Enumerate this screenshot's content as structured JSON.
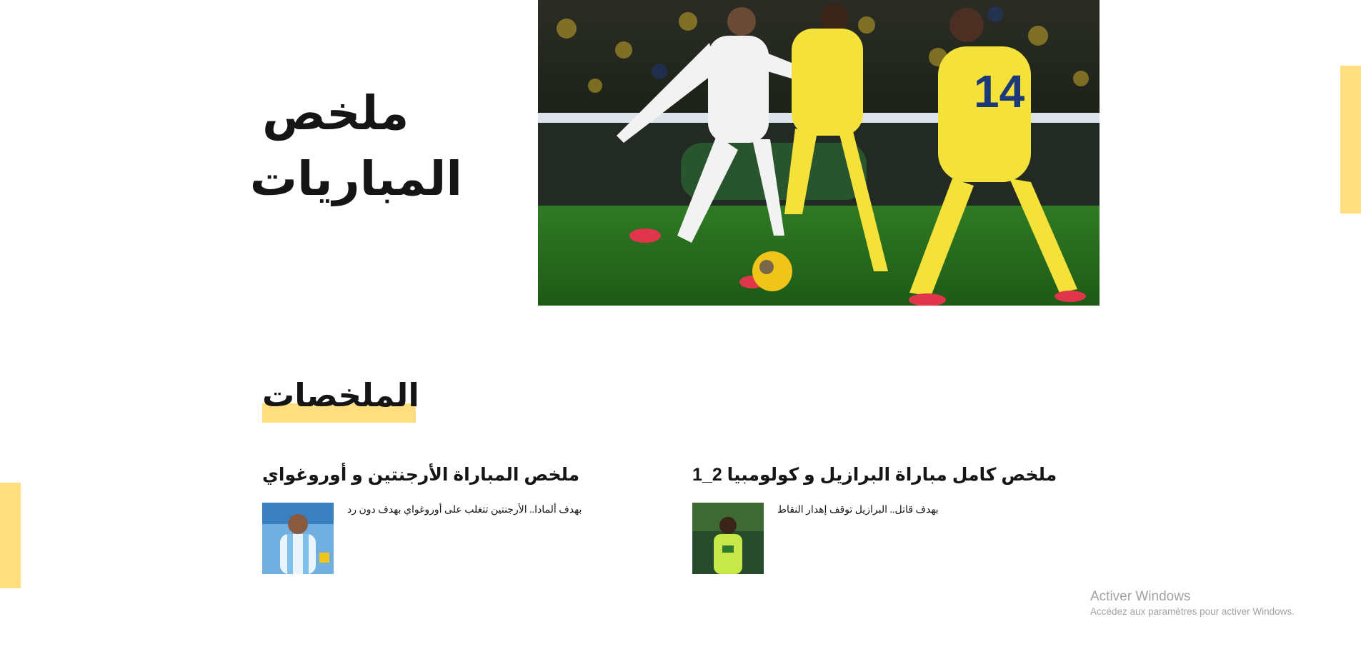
{
  "hero": {
    "title_line1": "ملخص",
    "title_line2": "المباريات",
    "photo": "football-match-photo"
  },
  "section": {
    "title": "الملخصات"
  },
  "cards": [
    {
      "title": "ملخص المباراة الأرجنتين و أوروغواي",
      "description": "بهدف ألمادا.. الأرجنتين تتغلب على أوروغواي بهدف دون رد",
      "thumbnail": "argentina-player-thumbnail"
    },
    {
      "title": "ملخص كامل مباراة البرازيل و كولومبيا 2_1",
      "description": "بهدف قاتل.. البرازيل توقف إهدار النقاط",
      "thumbnail": "brazil-player-thumbnail"
    }
  ],
  "watermark": {
    "title": "Activer Windows",
    "subtitle": "Accédez aux paramètres pour activer Windows."
  },
  "colors": {
    "accent": "#ffde80",
    "text": "#151515",
    "watermark": "#a2a2a2"
  }
}
